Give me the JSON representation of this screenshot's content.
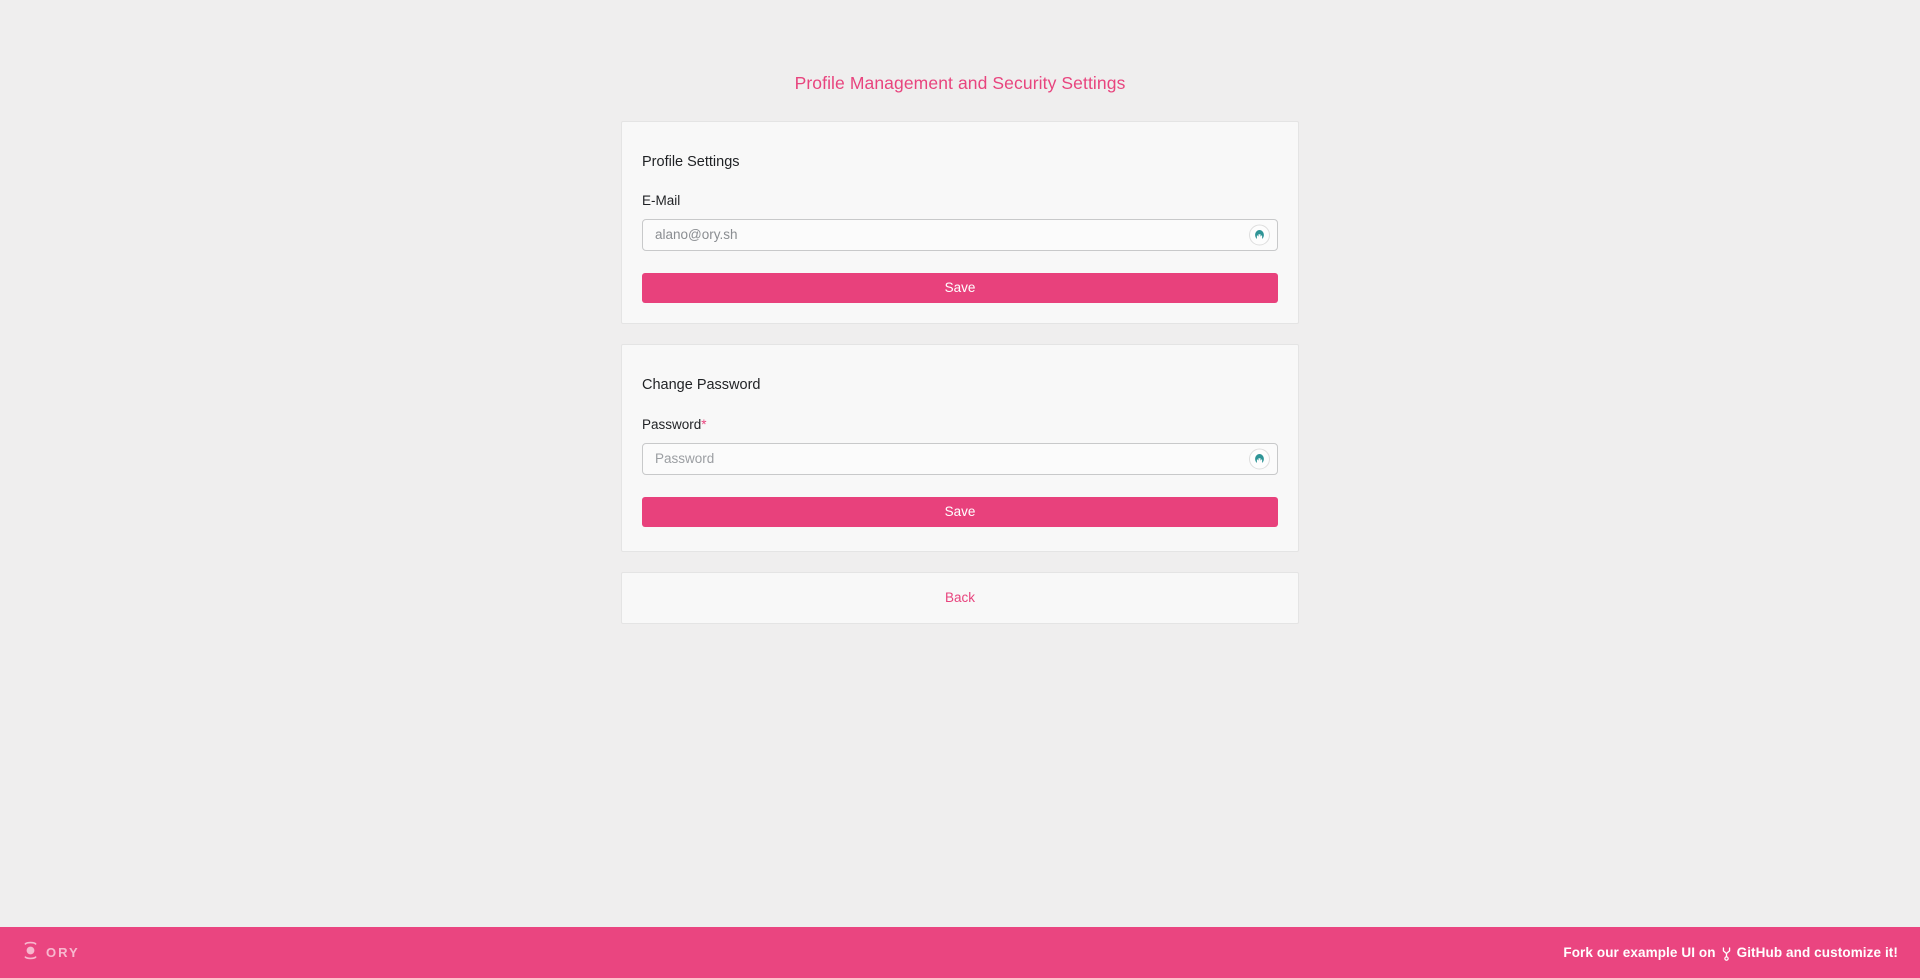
{
  "page": {
    "title": "Profile Management and Security Settings",
    "background_color": "#efeeee",
    "accent_color": "#e8447e"
  },
  "profile_card": {
    "heading": "Profile Settings",
    "email_label": "E-Mail",
    "email_value": "alano@ory.sh",
    "email_placeholder": "alano@ory.sh",
    "password_manager_icon": "password-manager-autofill-icon",
    "save_label": "Save"
  },
  "password_card": {
    "heading": "Change Password",
    "password_label": "Password",
    "required_mark": "*",
    "password_value": "",
    "password_placeholder": "Password",
    "password_manager_icon": "password-manager-autofill-icon",
    "save_label": "Save"
  },
  "back_card": {
    "back_label": "Back"
  },
  "footer": {
    "logo_wordmark": "ORY",
    "logo_icon": "ory-logo-icon",
    "text_before": "Fork our example UI on",
    "fork_icon": "git-fork-icon",
    "text_after": "GitHub and customize it!",
    "background_color": "#ea4580"
  }
}
